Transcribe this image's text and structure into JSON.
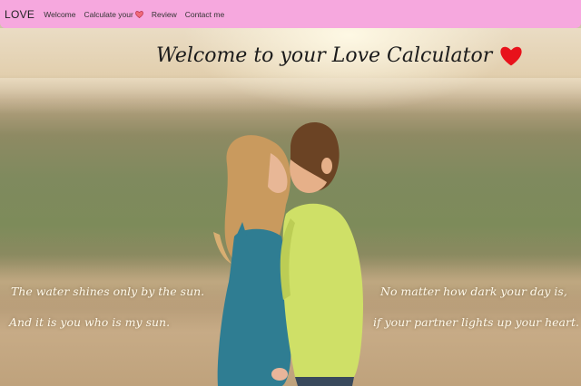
{
  "navbar": {
    "brand": "LOVE",
    "links": [
      {
        "label": "Welcome"
      },
      {
        "label": "Calculate your",
        "icon": "heart-icon"
      },
      {
        "label": "Review"
      },
      {
        "label": "Contact me"
      }
    ]
  },
  "hero": {
    "title": "Welcome to your Love Calculator",
    "title_icon": "heart-icon",
    "verse_left": [
      "The water shines only by the sun.",
      "And it is you who is my sun."
    ],
    "verse_right": [
      "No matter how dark your day is,",
      "if your partner lights up your heart."
    ]
  },
  "colors": {
    "navbar": "#f6a8de",
    "heart": "#e8121b",
    "verse_text": "#fff9ea"
  }
}
